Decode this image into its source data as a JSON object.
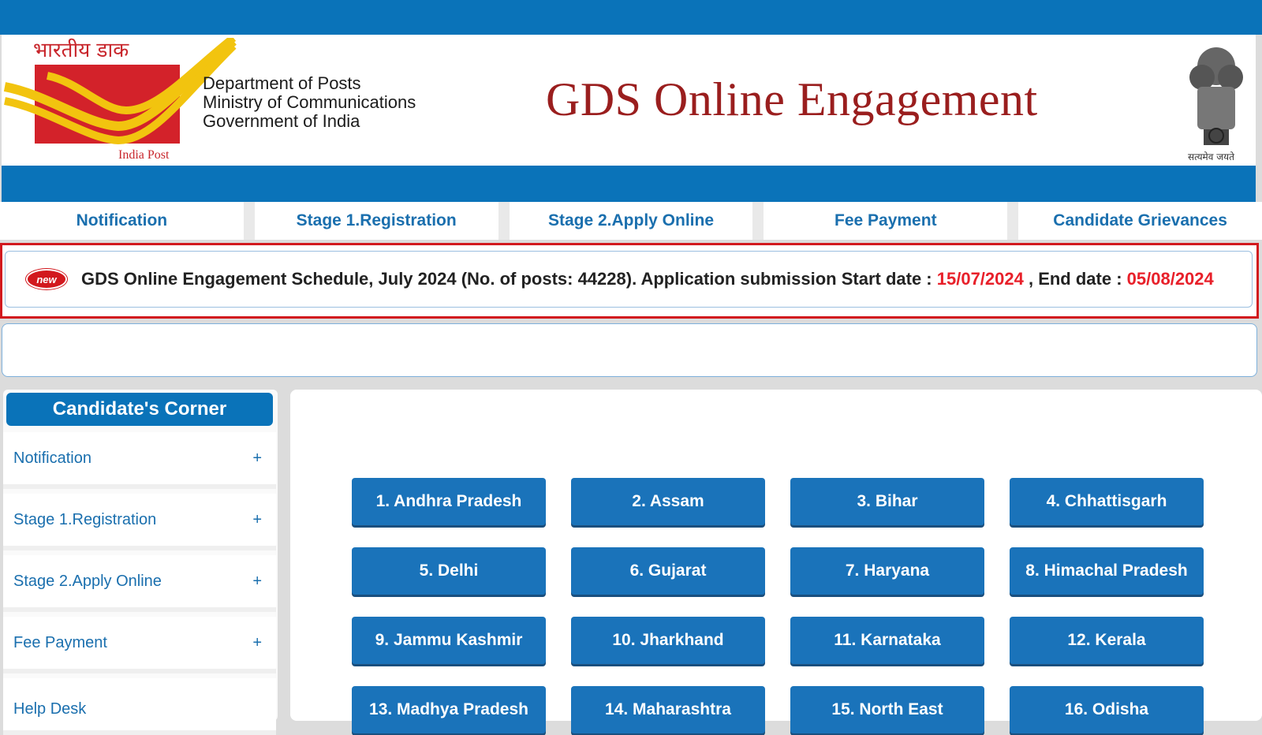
{
  "colors": {
    "primary_blue": "#0a73b9",
    "title_red": "#9a1e1e",
    "alert_red": "#e8202a"
  },
  "logo": {
    "hindi_text": "भारतीय डाक",
    "caption": "India Post",
    "icon": "india-post-logo"
  },
  "department": [
    "Department of Posts",
    "Ministry of Communications",
    "Government of India"
  ],
  "title": "GDS Online Engagement",
  "emblem": {
    "icon": "national-emblem",
    "motto": "सत्यमेव जयते"
  },
  "nav": [
    "Notification",
    "Stage 1.Registration",
    "Stage 2.Apply Online",
    "Fee Payment",
    "Candidate Grievances"
  ],
  "notice": {
    "badge": "new",
    "text": "GDS Online Engagement Schedule, July 2024 (No. of posts: 44228). Application submission Start date : ",
    "start_date": "15/07/2024",
    "middle": " , End date : ",
    "end_date": "05/08/2024"
  },
  "sidebar": {
    "title": "Candidate's Corner",
    "items": [
      {
        "label": "Notification",
        "icon": "+"
      },
      {
        "label": "Stage 1.Registration",
        "icon": "+"
      },
      {
        "label": "Stage 2.Apply Online",
        "icon": "+"
      },
      {
        "label": "Fee Payment",
        "icon": "+"
      },
      {
        "label": "Help Desk",
        "icon": "+"
      }
    ]
  },
  "states": [
    "1. Andhra Pradesh",
    "2. Assam",
    "3. Bihar",
    "4. Chhattisgarh",
    "5. Delhi",
    "6. Gujarat",
    "7. Haryana",
    "8. Himachal Pradesh",
    "9. Jammu Kashmir",
    "10. Jharkhand",
    "11. Karnataka",
    "12. Kerala",
    "13. Madhya Pradesh",
    "14. Maharashtra",
    "15. North East",
    "16. Odisha"
  ]
}
